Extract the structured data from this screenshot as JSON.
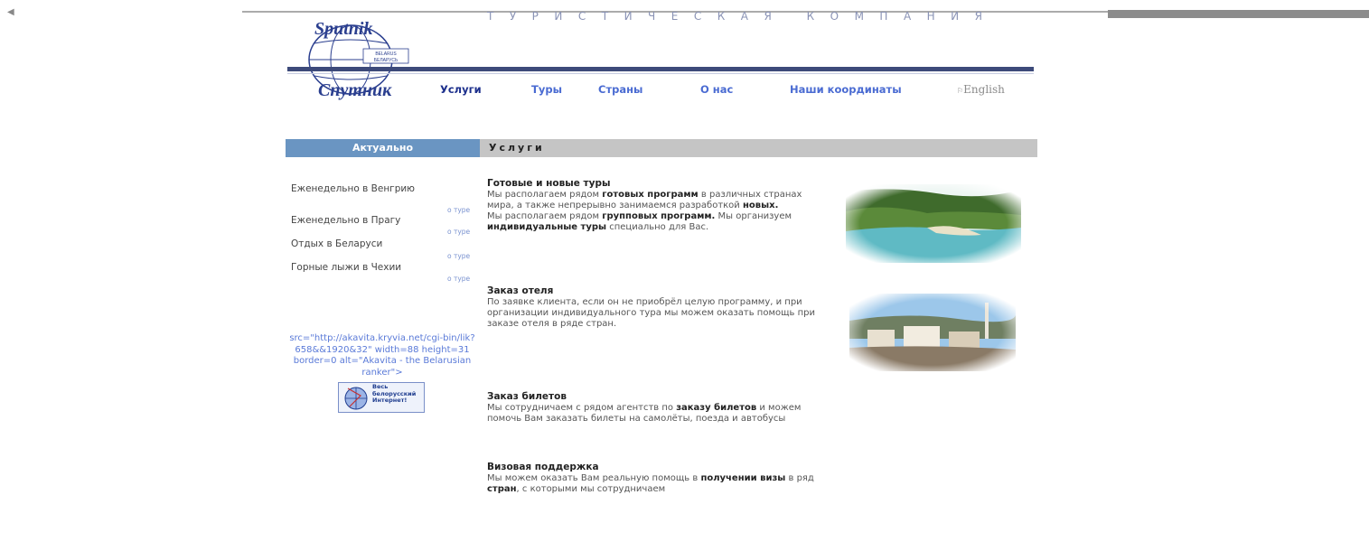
{
  "header": {
    "logo_text_top": "Sputnik",
    "logo_text_bottom": "Спутник",
    "logo_small_1": "BELARUS",
    "logo_small_2": "БЕЛАРУСЬ",
    "tagline": "ТУРИСТИЧЕСКАЯ КОМПАНИЯ",
    "lang_label": "English"
  },
  "nav": [
    {
      "label": "Услуги"
    },
    {
      "label": "Туры"
    },
    {
      "label": "Страны"
    },
    {
      "label": "О нас"
    },
    {
      "label": "Наши координаты"
    }
  ],
  "sidebar": {
    "heading": "Актуально",
    "items": [
      {
        "label": "Еженедельно в Венгрию",
        "link": "о туре"
      },
      {
        "label": "Еженедельно в Прагу",
        "link": "о туре"
      },
      {
        "label": "Отдых в Беларуси",
        "link": "о туре"
      },
      {
        "label": "Горные лыжи в Чехии",
        "link": "о туре"
      }
    ],
    "counter_text": "src=\"http://akavita.kryvia.net/cgi-bin/lik?658&&1920&32\" width=88 height=31 border=0 alt=\"Akavita - the Belarusian ranker\">",
    "banner_text": "Весь белорусский Интернет!"
  },
  "content": {
    "heading": "Услуги",
    "sections": [
      {
        "title": "Готовые и новые туры",
        "text_1": "Мы располагаем рядом ",
        "bold_1": "готовых программ",
        "text_2": " в различных странах мира, а также непрерывно занимаемся разработкой ",
        "bold_2": "новых.",
        "text_3": "Мы располагаем рядом ",
        "bold_3": "групповых программ.",
        "text_4": " Мы организуем ",
        "bold_4": "индивидуальные туры",
        "text_5": " специально для Вас."
      },
      {
        "title": "Заказ отеля",
        "text": "По заявке клиента, если он не приобрёл целую программу, и при организации индивидуального тура мы можем оказать помощь при заказе отеля в ряде стран."
      },
      {
        "title": "Заказ билетов",
        "text_1": "Мы сотрудничаем с рядом агентств по ",
        "bold_1": "заказу билетов",
        "text_2": " и можем помочь Вам заказать билеты на самолёты, поезда и автобусы"
      },
      {
        "title": "Визовая поддержка",
        "text_1": "Мы можем оказать Вам реальную помощь в ",
        "bold_1": "получении визы",
        "text_2": " в ряд ",
        "bold_2": "стран",
        "text_3": ", с которыми мы сотрудничаем"
      }
    ]
  },
  "colors": {
    "nav_link": "#4a6bd2",
    "header_rule": "#3d4a7a",
    "sidebar_bar": "#6a95c2",
    "content_bar": "#c5c5c5"
  },
  "icons": {
    "back": "left-arrow-icon",
    "lang": "flag-icon"
  }
}
